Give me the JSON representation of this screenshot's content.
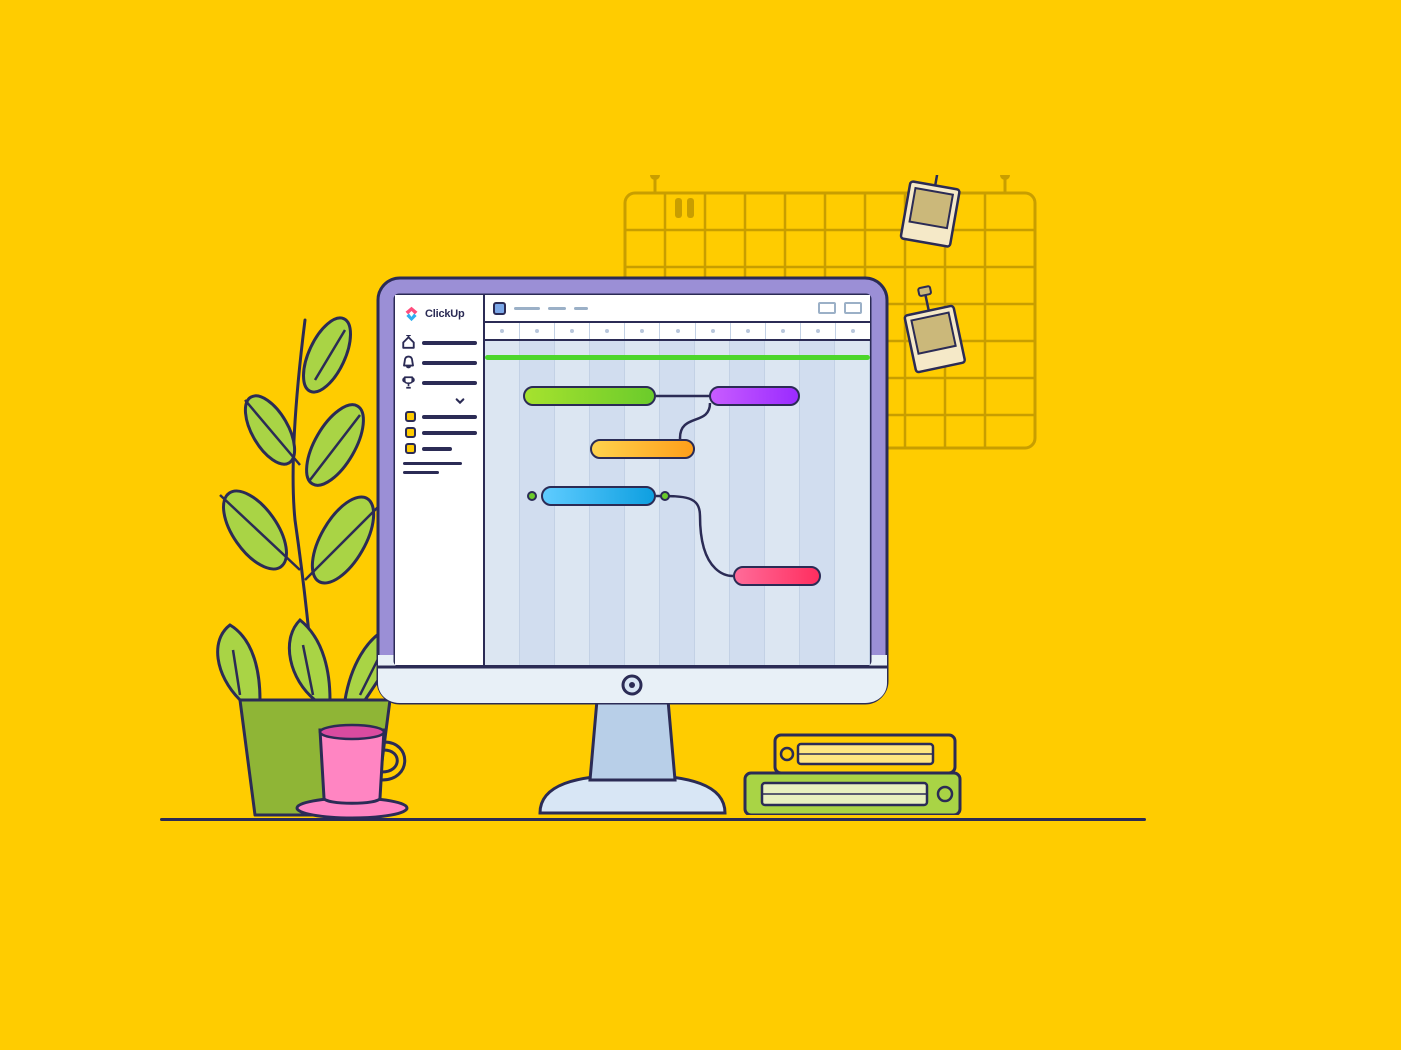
{
  "app": {
    "name": "ClickUp"
  },
  "colors": {
    "background": "#FFCC00",
    "stroke": "#2b2b55",
    "screen_bg": "#DCE6F2",
    "accent_green": "#78D431",
    "accent_purple": "#B940FF",
    "accent_orange": "#FFB300",
    "accent_blue": "#2EAEF0",
    "accent_pink": "#FF4D7D"
  },
  "sidebar": {
    "nav_icons": [
      "home",
      "bell",
      "trophy"
    ],
    "list_items": 3
  },
  "gantt": {
    "columns": 11,
    "bars": [
      {
        "id": "task-1",
        "color_start": "#A6E22E",
        "color_end": "#6BCB2B",
        "row": 1,
        "start": 1.1,
        "span": 3.8
      },
      {
        "id": "task-2",
        "color_start": "#C85CFF",
        "color_end": "#9A2BFF",
        "row": 1,
        "start": 6.4,
        "span": 2.6
      },
      {
        "id": "task-3",
        "color_start": "#FFD24D",
        "color_end": "#FF9F1A",
        "row": 2.3,
        "start": 3.0,
        "span": 3.0
      },
      {
        "id": "task-4",
        "color_start": "#5FCCFF",
        "color_end": "#0E9FE0",
        "row": 3.5,
        "start": 1.6,
        "span": 3.3,
        "handles": true
      },
      {
        "id": "task-5",
        "color_start": "#FF6B99",
        "color_end": "#FF2E5F",
        "row": 5.6,
        "start": 7.1,
        "span": 2.5
      }
    ]
  }
}
